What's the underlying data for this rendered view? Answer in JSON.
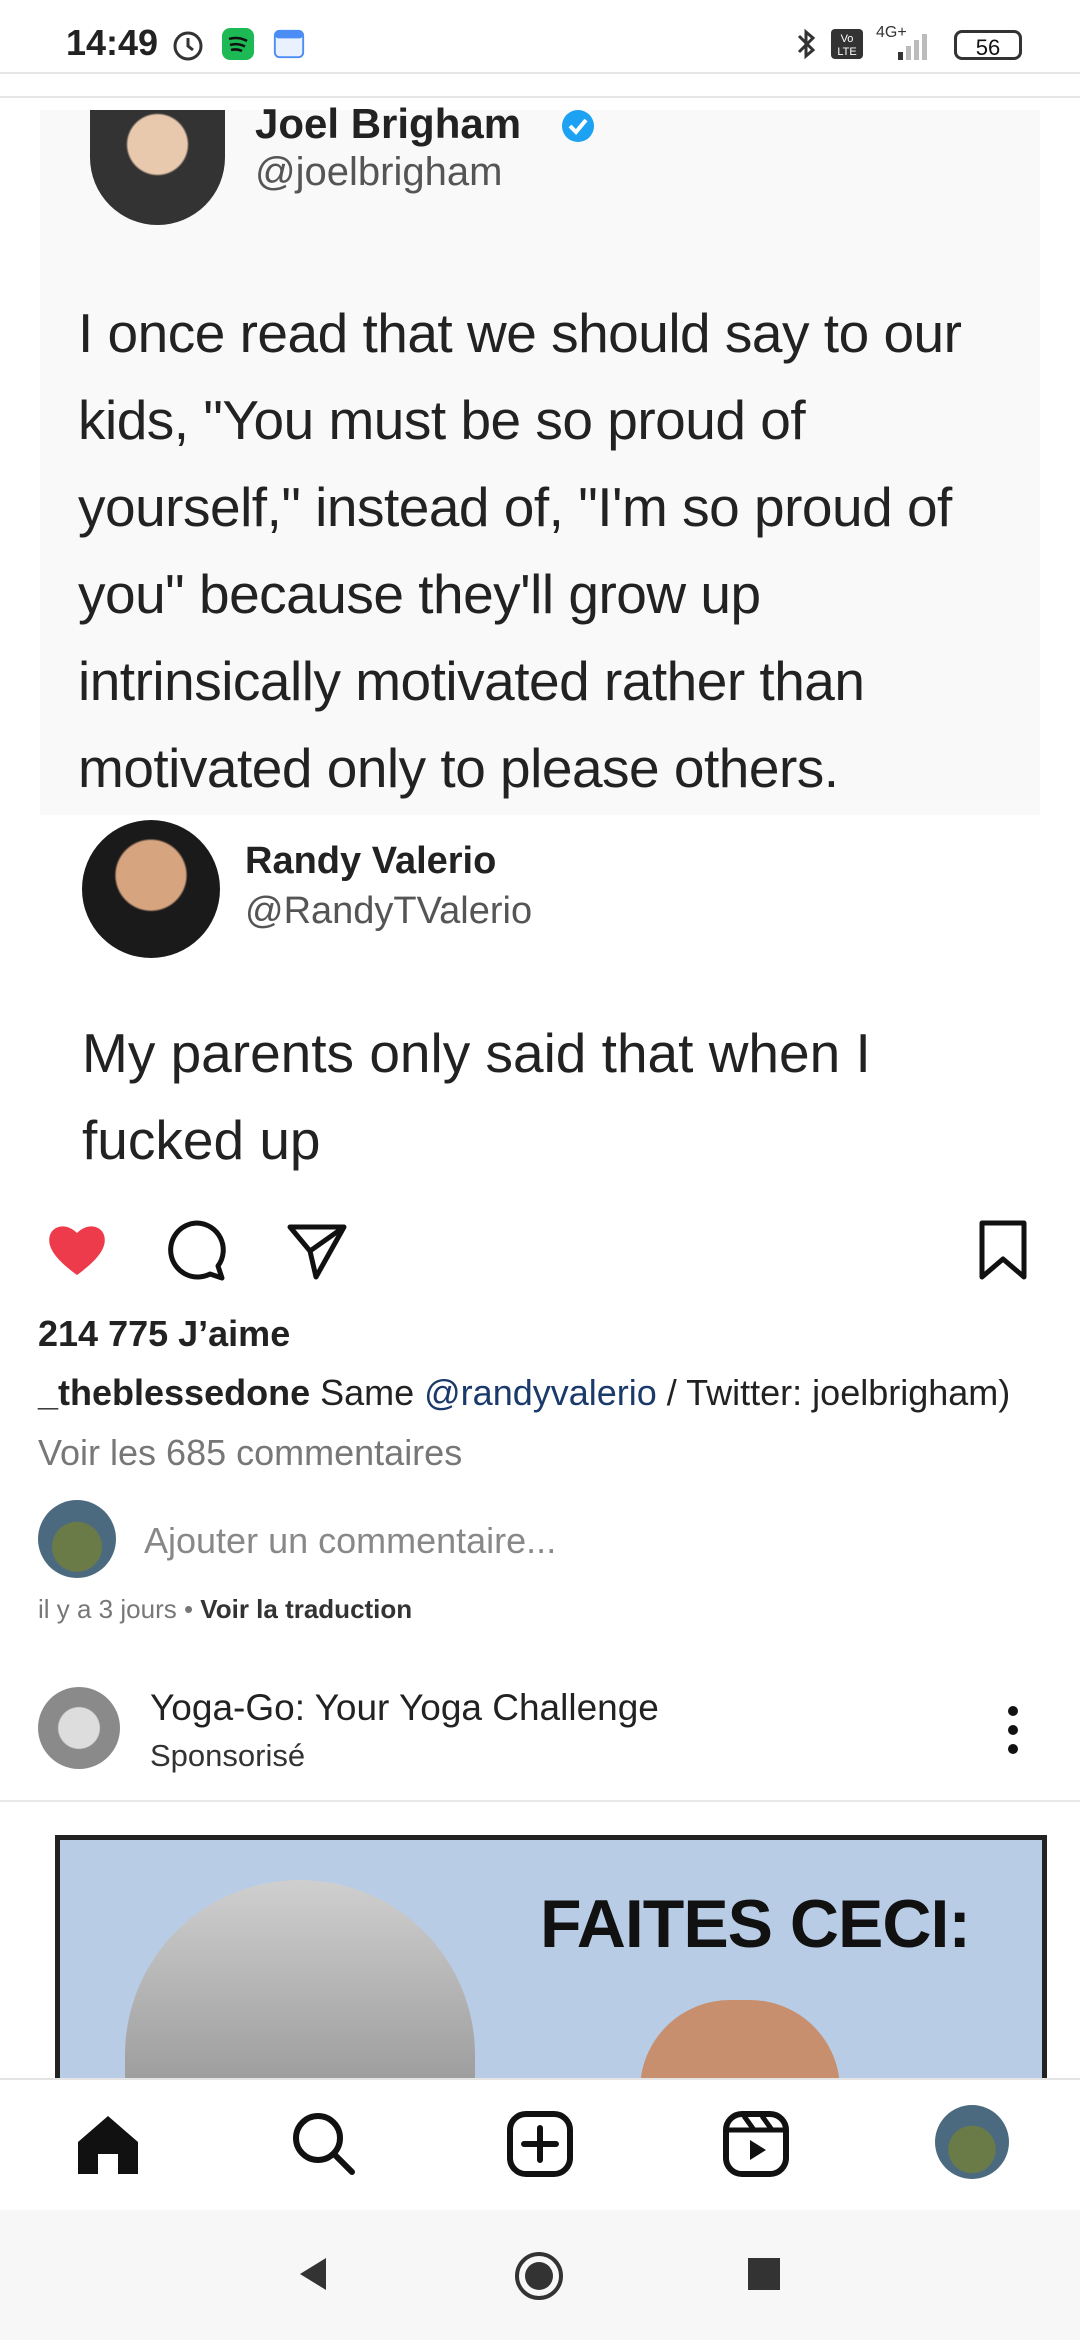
{
  "status_bar": {
    "time": "14:49",
    "battery": "56",
    "network": "4G+",
    "icons": [
      "alarm-icon",
      "spotify-icon",
      "calendar-icon",
      "bluetooth-icon",
      "volte-icon",
      "signal-icon",
      "battery-icon"
    ]
  },
  "tweet1": {
    "name": "Joel Brigham",
    "handle": "@joelbrigham",
    "text": "I once read that we should say to our kids, \"You must be so proud of yourself,\" instead of, \"I'm so proud of you\" because they'll grow up intrinsically motivated rather than motivated only to please others."
  },
  "tweet2": {
    "name": "Randy Valerio",
    "handle": "@RandyTValerio",
    "text": "My parents only said that when I fucked up"
  },
  "post": {
    "likes": "214 775 J’aime",
    "username": "_theblessedone",
    "caption_pre": " Same ",
    "mention": "@randyvalerio",
    "caption_post": " / Twitter: joelbrigham)",
    "view_comments": "Voir les 685 commentaires",
    "comment_placeholder": "Ajouter un commentaire...",
    "time_ago": "il y a 3 jours",
    "separator": " • ",
    "translate": "Voir la traduction"
  },
  "sponsored": {
    "name": "Yoga-Go: Your Yoga Challenge",
    "label": "Sponsorisé",
    "ad_text": "FAITES CECI:"
  },
  "colors": {
    "like": "#ed3b4b",
    "mention": "#1a3a6b"
  }
}
